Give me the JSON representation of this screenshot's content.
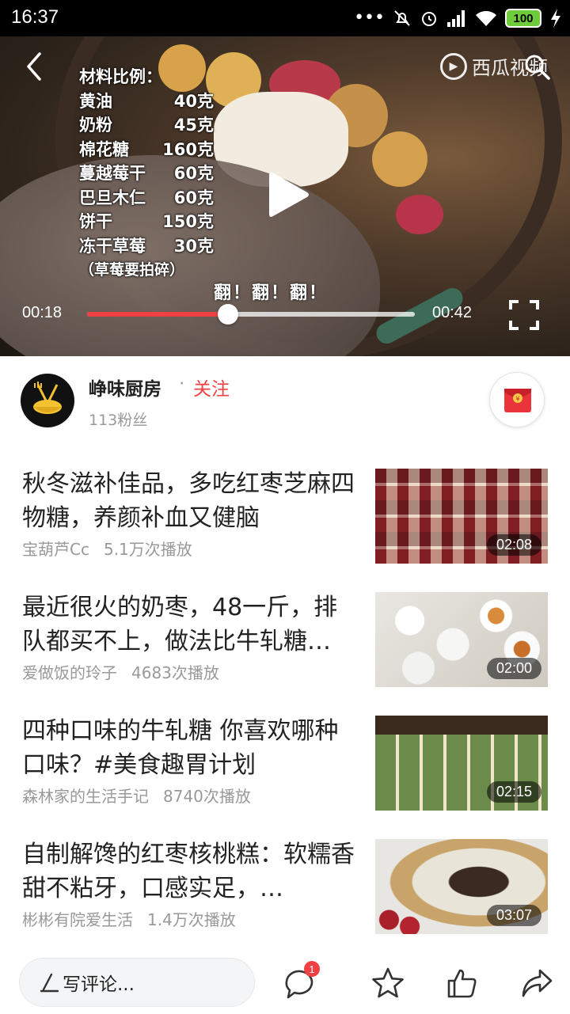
{
  "status_bar": {
    "time": "16:37",
    "battery": "100",
    "icons": [
      "more-dots-icon",
      "mute-bell-icon",
      "alarm-icon",
      "signal-icon",
      "wifi-icon",
      "battery-icon",
      "charging-icon"
    ]
  },
  "player": {
    "watermark": "西瓜视频",
    "recipe_title": "材料比例：",
    "recipe": [
      {
        "name": "黄油",
        "qty": "40克"
      },
      {
        "name": "奶粉",
        "qty": "45克"
      },
      {
        "name": "棉花糖",
        "qty": "160克"
      },
      {
        "name": "蔓越莓干",
        "qty": "60克"
      },
      {
        "name": "巴旦木仁",
        "qty": "60克"
      },
      {
        "name": "饼干",
        "qty": "150克"
      },
      {
        "name": "冻干草莓",
        "qty": "30克"
      }
    ],
    "recipe_note": "（草莓要拍碎）",
    "overlay_text": "翻！翻！翻！",
    "current_time": "00:18",
    "total_time": "00:42",
    "progress": 0.43,
    "accent_color": "#f04142"
  },
  "author": {
    "name": "峥味厨房",
    "dot": "·",
    "follow_label": "关注",
    "fans": "113粉丝"
  },
  "related": [
    {
      "title": "秋冬滋补佳品，多吃红枣芝麻四物糖，养颜补血又健脑",
      "author": "宝葫芦Cc",
      "plays": "5.1万次播放",
      "duration": "02:08"
    },
    {
      "title": "最近很火的奶枣，48一斤，排队都买不上，做法比牛轧糖…",
      "author": "爱做饭的玲子",
      "plays": "4683次播放",
      "duration": "02:00"
    },
    {
      "title": "四种口味的牛轧糖 你喜欢哪种口味？#美食趣胃计划",
      "author": "森林家的生活手记",
      "plays": "8740次播放",
      "duration": "02:15"
    },
    {
      "title": "自制解馋的红枣核桃糕：软糯香甜不粘牙，口感实足，…",
      "author": "彬彬有院爱生活",
      "plays": "1.4万次播放",
      "duration": "03:07"
    }
  ],
  "bottom_bar": {
    "comment_placeholder": "写评论...",
    "comment_count": "1"
  }
}
